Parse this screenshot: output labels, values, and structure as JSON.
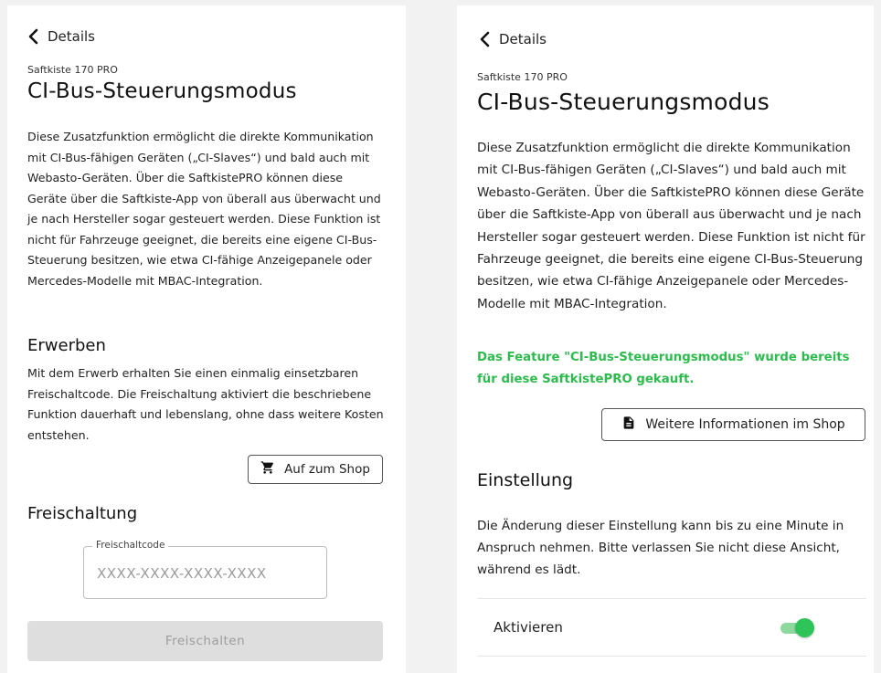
{
  "left": {
    "back_label": "Details",
    "device": "Saftkiste 170 PRO",
    "title": "CI-Bus-Steuerungsmodus",
    "description": "Diese Zusatzfunktion ermöglicht die direkte Kommunikation mit CI-Bus-fähigen Geräten („CI-Slaves“) und bald auch mit Webasto-Geräten. Über die SaftkistePRO können diese Geräte über die Saftkiste-App von überall aus überwacht und je nach Hersteller sogar gesteuert werden. Diese Funktion ist nicht für Fahrzeuge geeignet, die bereits eine eigene CI-Bus-Steuerung besitzen, wie etwa CI-fähige Anzeigepanele oder Mercedes-Modelle mit MBAC-Integration.",
    "purchase_heading": "Erwerben",
    "purchase_text": "Mit dem Erwerb erhalten Sie einen einmalig einsetzbaren Freischaltcode. Die Freischaltung aktiviert die beschriebene Funktion dauerhaft und lebenslang, ohne dass weitere Kosten entstehen.",
    "shop_button": "Auf zum Shop",
    "unlock_heading": "Freischaltung",
    "code_label": "Freischaltcode",
    "code_placeholder": "XXXX-XXXX-XXXX-XXXX",
    "unlock_button": "Freischalten"
  },
  "right": {
    "back_label": "Details",
    "device": "Saftkiste 170 PRO",
    "title": "CI-Bus-Steuerungsmodus",
    "description": "Diese Zusatzfunktion ermöglicht die direkte Kommunikation mit CI-Bus-fähigen Geräten („CI-Slaves“) und bald auch mit Webasto-Geräten. Über die SaftkistePRO können diese Geräte über die Saftkiste-App von überall aus überwacht und je nach Hersteller sogar gesteuert werden. Diese Funktion ist nicht für Fahrzeuge geeignet, die bereits eine eigene CI-Bus-Steuerung besitzen, wie etwa CI-fähige Anzeigepanele oder Mercedes-Modelle mit MBAC-Integration.",
    "purchased_notice": "Das Feature \"CI-Bus-Steuerungsmodus\" wurde bereits für diese SaftkistePRO gekauft.",
    "info_button": "Weitere Informationen im Shop",
    "settings_heading": "Einstellung",
    "settings_text": "Die Änderung dieser Einstellung kann bis zu eine Minute in Anspruch nehmen. Bitte verlassen Sie nicht diese Ansicht, während es lädt.",
    "toggle_label": "Aktivieren",
    "toggle_on": true
  },
  "colors": {
    "success": "#2dbb4e",
    "toggle_thumb": "#2ec45a",
    "toggle_track": "#8ed79e",
    "disabled_bg": "#dedede"
  }
}
